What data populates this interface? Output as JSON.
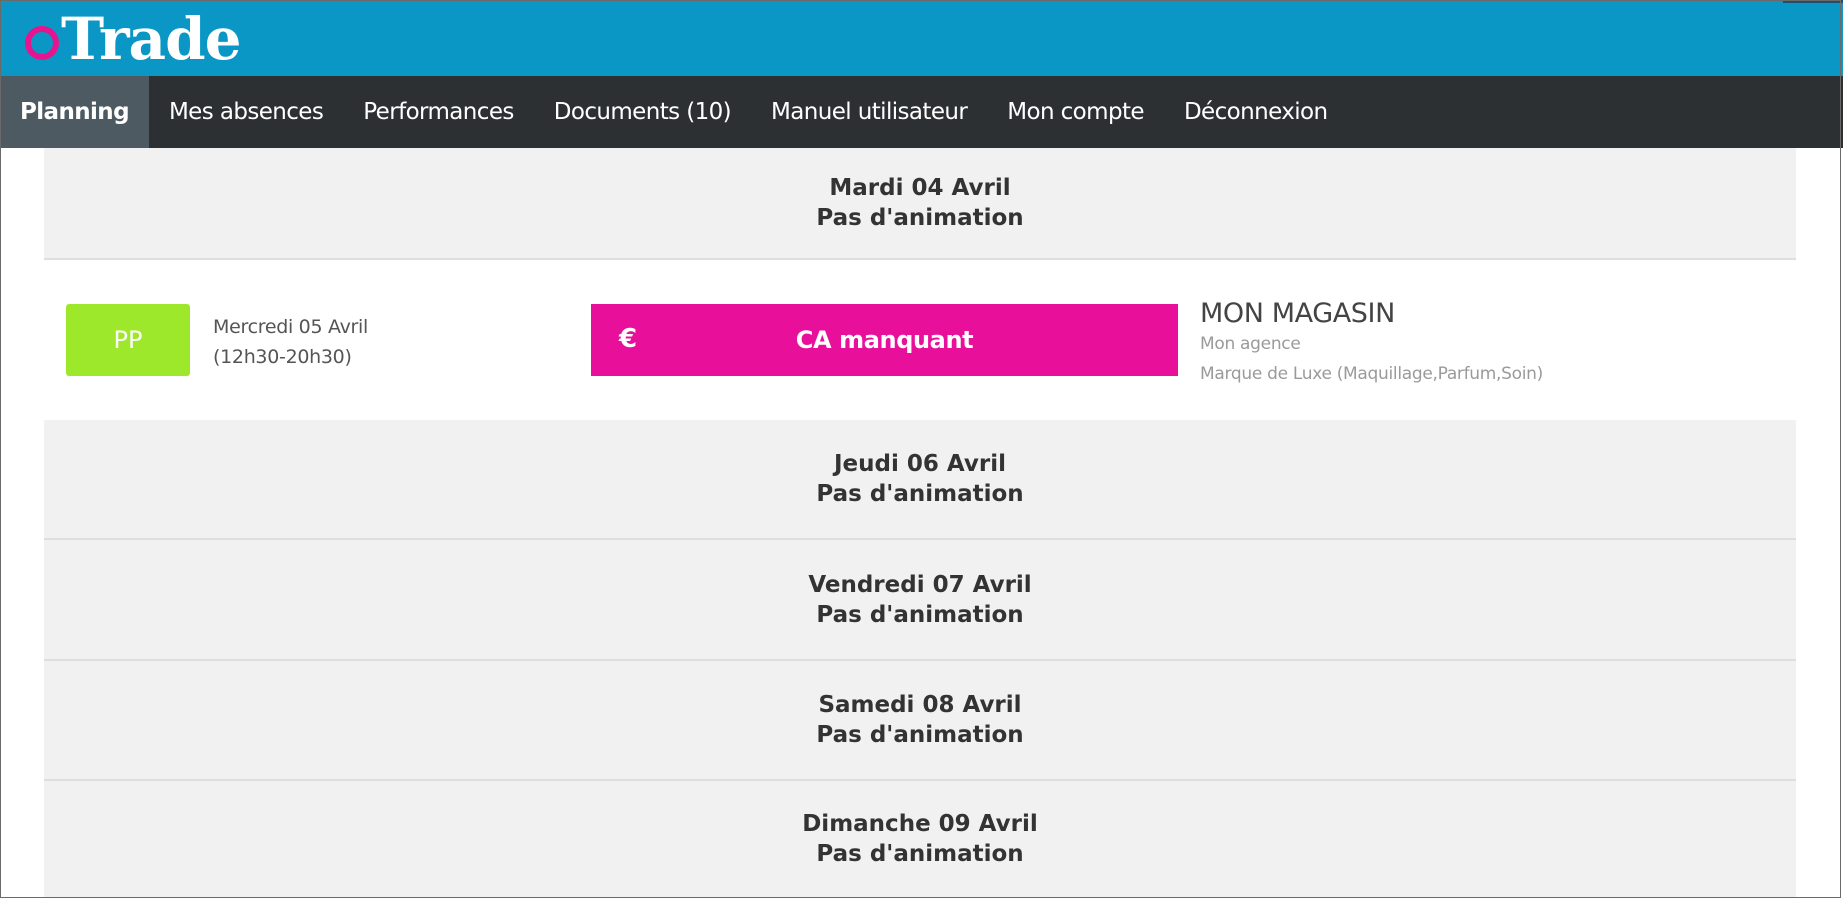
{
  "header": {
    "logo_text": "Trade",
    "logo_mark_color": "#e5158f",
    "background_color": "#0a97c6"
  },
  "nav": {
    "items": [
      {
        "label": "Planning",
        "active": true
      },
      {
        "label": "Mes absences"
      },
      {
        "label": "Performances"
      },
      {
        "label": "Documents (10)"
      },
      {
        "label": "Manuel utilisateur"
      },
      {
        "label": "Mon compte"
      },
      {
        "label": "Déconnexion"
      }
    ]
  },
  "planning": {
    "days": [
      {
        "date": "Mardi 04 Avril",
        "status": "Pas d'animation"
      },
      {
        "date": "Jeudi 06 Avril",
        "status": "Pas d'animation"
      },
      {
        "date": "Vendredi 07 Avril",
        "status": "Pas d'animation"
      },
      {
        "date": "Samedi 08 Avril",
        "status": "Pas d'animation"
      },
      {
        "date": "Dimanche 09 Avril",
        "status": "Pas d'animation"
      }
    ],
    "event": {
      "badge": "PP",
      "badge_color": "#9ee82b",
      "date": "Mercredi 05 Avril",
      "hours": "(12h30-20h30)",
      "action_icon": "€",
      "action_icon_name": "euro-icon",
      "action_label": "CA manquant",
      "action_color": "#e8109b",
      "shop_name": "MON MAGASIN",
      "agency": "Mon agence",
      "brand": "Marque de Luxe (Maquillage,Parfum,Soin)"
    }
  }
}
